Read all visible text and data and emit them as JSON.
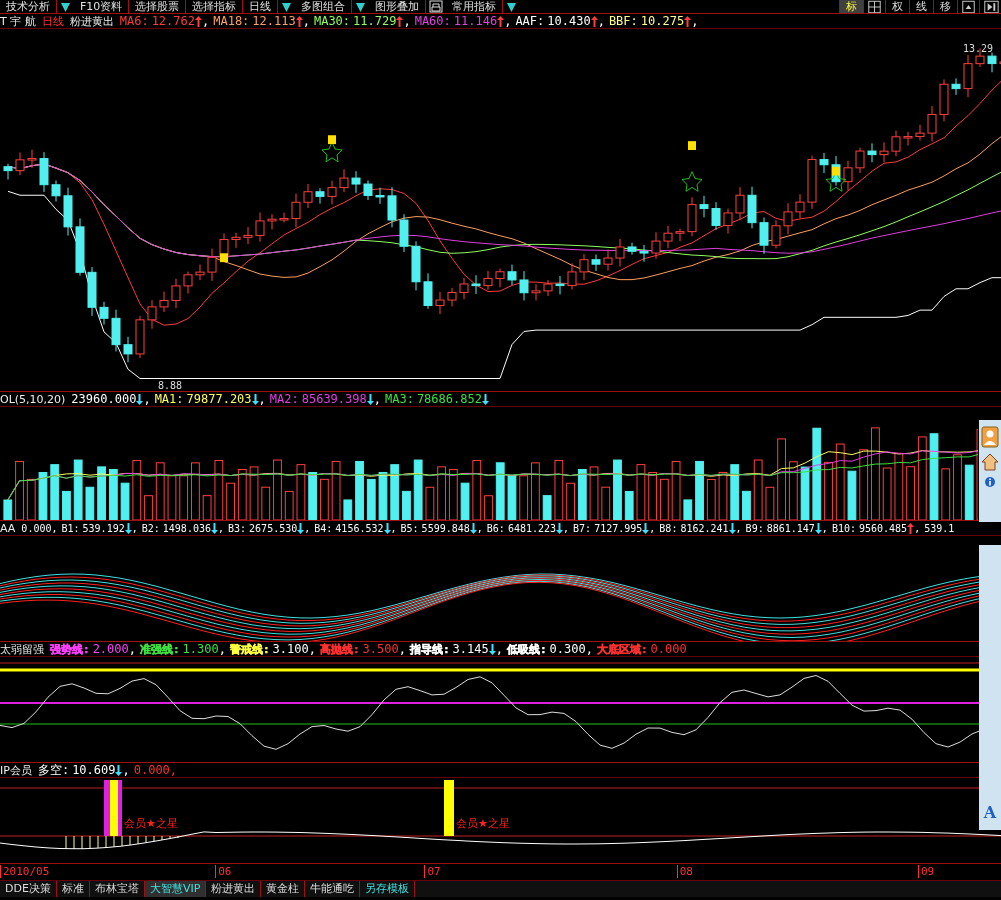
{
  "toolbar": {
    "items": [
      {
        "label": "技术分析",
        "dropdown": true
      },
      {
        "label": "F10资料",
        "dropdown": false
      },
      {
        "label": "选择股票",
        "dropdown": false
      },
      {
        "label": "选择指标",
        "dropdown": false
      },
      {
        "label": "日线",
        "dropdown": true
      },
      {
        "label": "多图组合",
        "dropdown": true
      },
      {
        "label": "图形叠加",
        "dropdown": false
      },
      {
        "label": "常用指标",
        "dropdown": true
      }
    ],
    "right_tools": [
      {
        "label": "标",
        "selected": true
      },
      {
        "label": "权",
        "selected": false
      },
      {
        "label": "线",
        "selected": false
      },
      {
        "label": "移",
        "selected": false
      }
    ]
  },
  "main_chart": {
    "stock": "T 宇 航",
    "period": "日线",
    "formula": "粉进黄出",
    "values": [
      {
        "name": "MA6:",
        "value": "12.762",
        "rising": true,
        "tail": ",",
        "color": "#ff3c3c"
      },
      {
        "name": "MA18:",
        "value": "12.113",
        "rising": true,
        "tail": ",",
        "color": "#ffa060"
      },
      {
        "name": "MA30:",
        "value": "11.729",
        "rising": true,
        "tail": ",",
        "color": "#90ff60"
      },
      {
        "name": "MA60:",
        "value": "11.146",
        "rising": true,
        "tail": ",",
        "color": "#e040e0"
      },
      {
        "name": "AAF:",
        "value": "10.430",
        "rising": true,
        "tail": ",",
        "color": "#ffffff"
      },
      {
        "name": "BBF:",
        "value": "10.275",
        "rising": true,
        "tail": ",",
        "color": "#ffff90"
      }
    ],
    "high_label": "13.29",
    "low_label": "8.88"
  },
  "volume": {
    "title": "OL(5,10,20)",
    "values": [
      {
        "value": "23960.000",
        "rising": false,
        "tail": ",",
        "color": "#ffffff"
      },
      {
        "name": "MA1:",
        "value": "79877.203",
        "rising": false,
        "tail": ",",
        "color": "#ffff60"
      },
      {
        "name": "MA2:",
        "value": "85639.398",
        "rising": false,
        "tail": ",",
        "color": "#e040e0"
      },
      {
        "name": "MA3:",
        "value": "78686.852",
        "rising": false,
        "color": "#40e040"
      }
    ]
  },
  "ribbon": {
    "title": "AA",
    "values": [
      {
        "value": "0.000",
        "tail": ","
      },
      {
        "name": "B1:",
        "value": "539.192",
        "rising": false,
        "tail": ","
      },
      {
        "name": "B2:",
        "value": "1498.036",
        "rising": false,
        "tail": ","
      },
      {
        "name": "B3:",
        "value": "2675.530",
        "rising": false,
        "tail": ","
      },
      {
        "name": "B4:",
        "value": "4156.532",
        "rising": false,
        "tail": ","
      },
      {
        "name": "B5:",
        "value": "5599.848",
        "rising": false,
        "tail": ","
      },
      {
        "name": "B6:",
        "value": "6481.223",
        "rising": false,
        "tail": ","
      },
      {
        "name": "B7:",
        "value": "7127.995",
        "rising": false,
        "tail": ","
      },
      {
        "name": "B8:",
        "value": "8162.241",
        "rising": false,
        "tail": ","
      },
      {
        "name": "B9:",
        "value": "8861.147",
        "rising": false,
        "tail": ","
      },
      {
        "name": "B10:",
        "value": "9560.485",
        "rising": true,
        "tail": ","
      },
      {
        "value": "539.1"
      }
    ]
  },
  "strength": {
    "title": "太弱留强",
    "values": [
      {
        "name": "强势线:",
        "value": "2.000",
        "tail": ",",
        "color": "#ff40ff"
      },
      {
        "name": "准强线:",
        "value": "1.300",
        "tail": ",",
        "color": "#40e040"
      },
      {
        "name": "警戒线:",
        "color": "#ffff40"
      },
      {
        "value": "3.100",
        "tail": ",",
        "color": "#ffffff"
      },
      {
        "name": "高抛线:",
        "value": "3.500",
        "tail": ",",
        "color": "#ff3030"
      },
      {
        "name": "指导线:",
        "value": "3.145",
        "rising": false,
        "tail": ",",
        "color": "#ffffff"
      },
      {
        "name": "低吸线:",
        "value": "0.300",
        "tail": ",",
        "color": "#ffffff"
      },
      {
        "name": "大底区域:",
        "value": "0.000",
        "color": "#ff3030"
      }
    ]
  },
  "vip": {
    "title": "IP会员",
    "values": [
      {
        "name": "多空:",
        "value": "10.609",
        "rising": false,
        "tail": ",",
        "color": "#ffffff"
      },
      {
        "value": "0.000,",
        "color": "#ff3030"
      }
    ],
    "marks": [
      "会员★之星",
      "会员★之星"
    ]
  },
  "date_axis": [
    "2010/05",
    "06",
    "07",
    "08",
    "09"
  ],
  "bottom_tabs": [
    {
      "label": "DDE决策",
      "selected": false,
      "kind": "tab"
    },
    {
      "label": "标准",
      "selected": false,
      "kind": "tab"
    },
    {
      "label": "布林宝塔",
      "selected": false,
      "kind": "tab"
    },
    {
      "label": "大智慧VIP",
      "selected": true,
      "kind": "tab"
    },
    {
      "label": "粉进黄出",
      "selected": false,
      "kind": "tab"
    },
    {
      "label": "黄金柱",
      "selected": false,
      "kind": "tab"
    },
    {
      "label": "牛能通吃",
      "selected": false,
      "kind": "tab"
    },
    {
      "label": "另存模板",
      "selected": false,
      "kind": "action"
    }
  ],
  "side_panel": {
    "letter": "A"
  }
}
